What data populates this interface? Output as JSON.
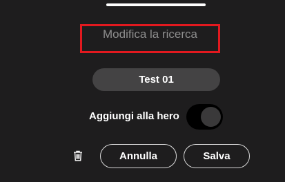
{
  "sheet": {
    "title": "Modifica la ricerca",
    "name_value": "Test 01",
    "toggle": {
      "label": "Aggiungi alla hero",
      "state": "off"
    },
    "actions": {
      "delete_icon": "trash-icon",
      "cancel_label": "Annulla",
      "save_label": "Salva"
    }
  },
  "colors": {
    "background": "#1e1d1e",
    "highlight_border": "#e2191f",
    "pill": "#444344",
    "text": "#ffffff",
    "title_text": "#8e8e8e"
  }
}
